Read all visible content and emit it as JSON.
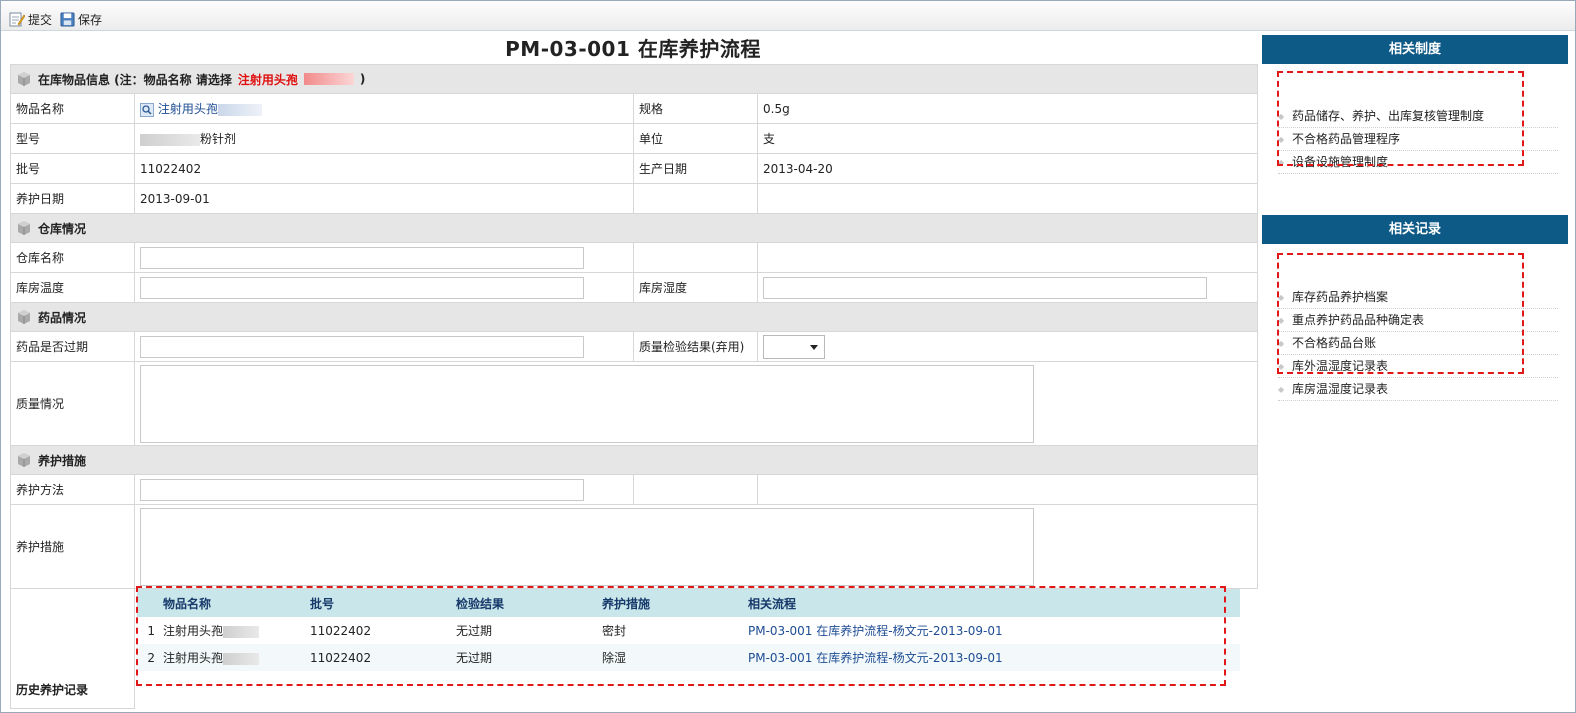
{
  "toolbar": {
    "submit_label": "提交",
    "save_label": "保存"
  },
  "page_title": "PM-03-001 在库养护流程",
  "sections": {
    "item_info": {
      "title": "在库物品信息 (注：物品名称 请选择",
      "highlight": "注射用头孢"
    },
    "warehouse": {
      "title": "仓库情况"
    },
    "drug": {
      "title": "药品情况"
    },
    "maintenance": {
      "title": "养护措施"
    }
  },
  "fields": {
    "item_name": {
      "label": "物品名称",
      "value": "注射用头孢"
    },
    "spec": {
      "label": "规格",
      "value": "0.5g"
    },
    "model": {
      "label": "型号",
      "value": "粉针剂"
    },
    "unit": {
      "label": "单位",
      "value": "支"
    },
    "batch": {
      "label": "批号",
      "value": "11022402"
    },
    "mfg_date": {
      "label": "生产日期",
      "value": "2013-04-20"
    },
    "maint_date": {
      "label": "养护日期",
      "value": "2013-09-01"
    },
    "warehouse_name": {
      "label": "仓库名称",
      "value": ""
    },
    "room_temp": {
      "label": "库房温度",
      "value": ""
    },
    "room_humidity": {
      "label": "库房湿度",
      "value": ""
    },
    "expired": {
      "label": "药品是否过期",
      "value": ""
    },
    "qc_result": {
      "label": "质量检验结果(弃用)",
      "value": ""
    },
    "quality": {
      "label": "质量情况",
      "value": ""
    },
    "method": {
      "label": "养护方法",
      "value": ""
    },
    "measures": {
      "label": "养护措施",
      "value": ""
    },
    "history": {
      "label": "历史养护记录"
    }
  },
  "history": {
    "headers": [
      "物品名称",
      "批号",
      "检验结果",
      "养护措施",
      "相关流程"
    ],
    "rows": [
      {
        "no": "1",
        "name": "注射用头孢",
        "batch": "11022402",
        "result": "无过期",
        "measure": "密封",
        "flow": "PM-03-001 在库养护流程-杨文元-2013-09-01"
      },
      {
        "no": "2",
        "name": "注射用头孢",
        "batch": "11022402",
        "result": "无过期",
        "measure": "除湿",
        "flow": "PM-03-001 在库养护流程-杨文元-2013-09-01"
      }
    ]
  },
  "sidebar": {
    "policies": {
      "title": "相关制度",
      "items": [
        "药品储存、养护、出库复核管理制度",
        "不合格药品管理程序",
        "设备设施管理制度"
      ]
    },
    "records": {
      "title": "相关记录",
      "items": [
        "库存药品养护档案",
        "重点养护药品品种确定表",
        "不合格药品台账",
        "库外温湿度记录表",
        "库房温湿度记录表"
      ]
    }
  },
  "colors": {
    "panel_header": "#0e5a86",
    "highlight_red": "#e01010",
    "link_blue": "#1d4c94",
    "section_bg": "#e6e6e6",
    "history_header": "#c9e6ea"
  }
}
